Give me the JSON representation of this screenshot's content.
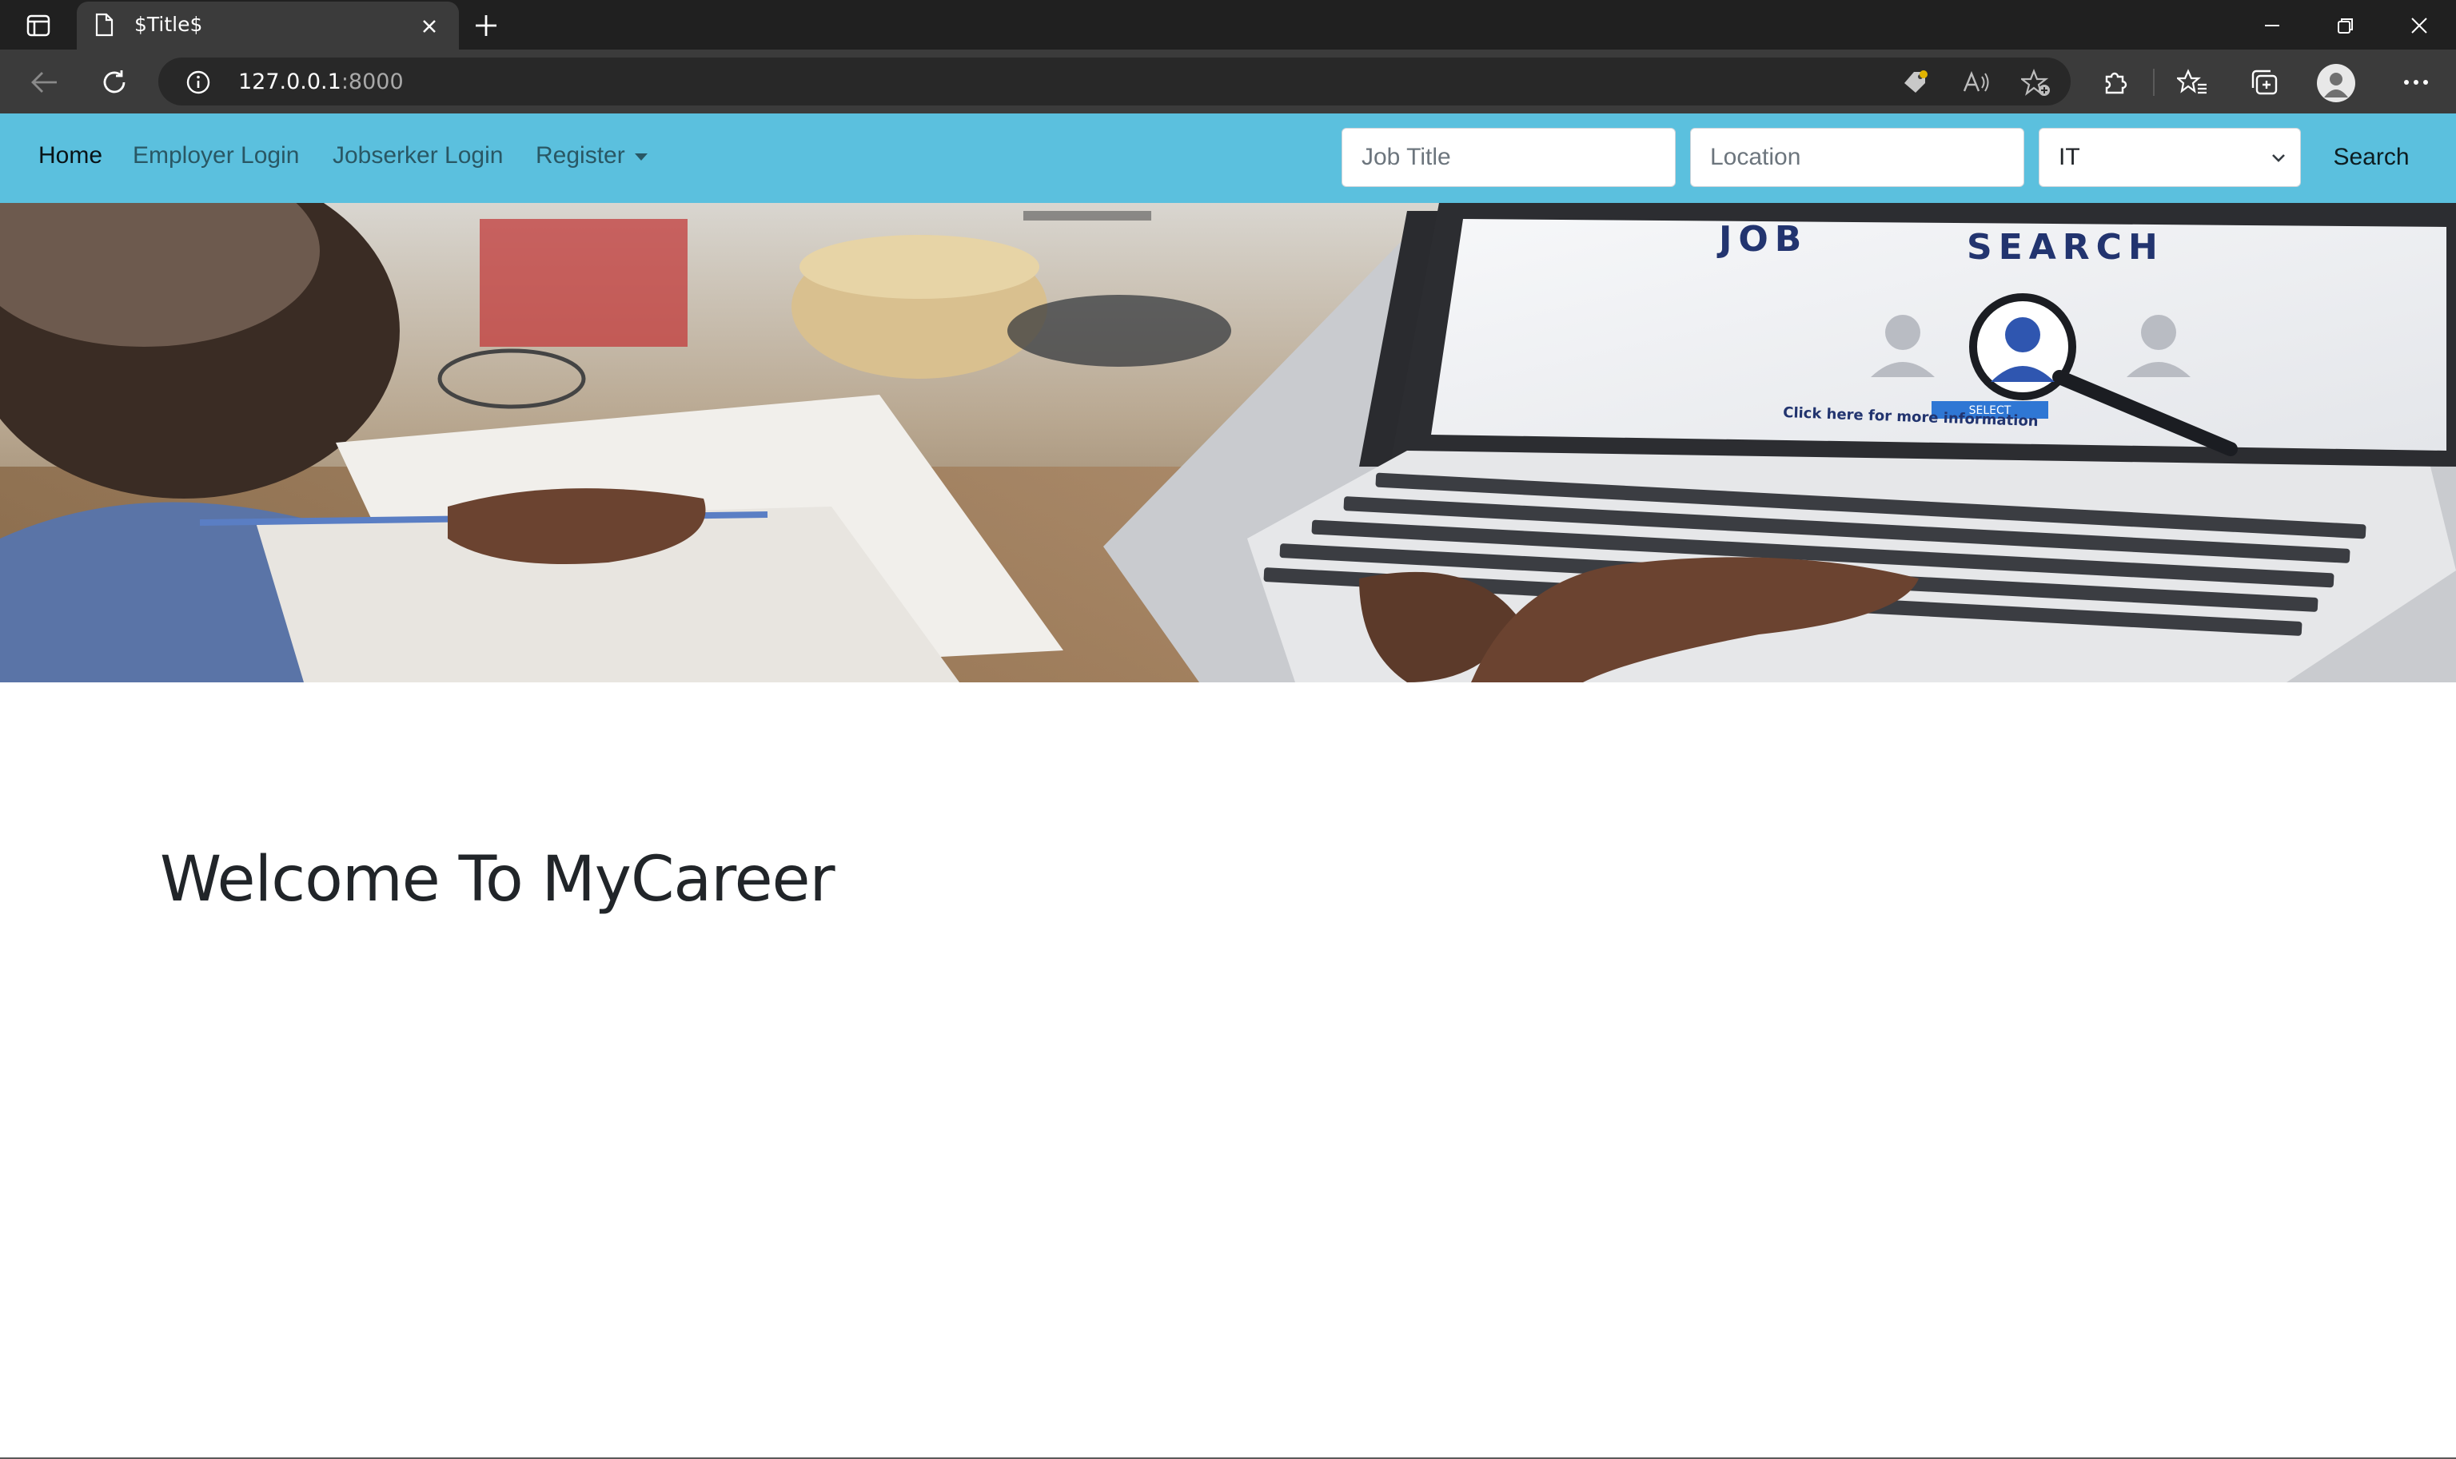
{
  "browser": {
    "tab_title": "$Title$",
    "url_host": "127.0.0.1",
    "url_port": ":8000"
  },
  "navbar": {
    "links": [
      {
        "label": "Home",
        "active": true
      },
      {
        "label": "Employer Login",
        "active": false
      },
      {
        "label": "Jobserker Login",
        "active": false
      },
      {
        "label": "Register",
        "active": false,
        "dropdown": true
      }
    ],
    "job_title_placeholder": "Job Title",
    "location_placeholder": "Location",
    "category_selected": "IT",
    "search_label": "Search",
    "bg_color": "#5bc0de"
  },
  "hero": {
    "screen_heading_left": "JOB",
    "screen_heading_right": "SEARCH",
    "select_badge": "SELECT",
    "screen_caption": "Click here for more information"
  },
  "main": {
    "welcome": "Welcome To MyCareer"
  }
}
